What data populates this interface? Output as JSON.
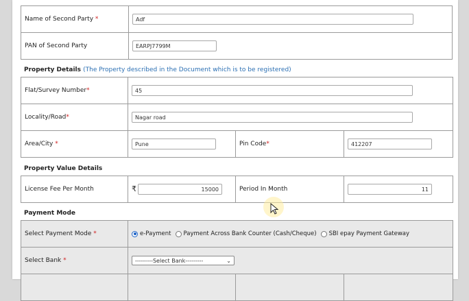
{
  "second_party": {
    "name_label": "Name of Second Party",
    "name_value": "Adf",
    "pan_label": "PAN of Second Party",
    "pan_value": "EARPJ7799M"
  },
  "property": {
    "title": "Property Details",
    "note": "(The Property described in the Document which is to be registered)",
    "flat_label": "Flat/Survey Number",
    "flat_value": "45",
    "locality_label": "Locality/Road",
    "locality_value": "Nagar road",
    "city_label": "Area/City",
    "city_value": "Pune",
    "pin_label": "Pin Code",
    "pin_value": "412207"
  },
  "value_details": {
    "title": "Property Value Details",
    "fee_label": "License Fee Per Month",
    "currency": "₹",
    "fee_value": "15000",
    "period_label": "Period In Month",
    "period_value": "11"
  },
  "payment": {
    "title": "Payment Mode",
    "mode_label": "Select Payment Mode",
    "options": [
      "e-Payment",
      "Payment Across Bank Counter (Cash/Cheque)",
      "SBI epay Payment Gateway"
    ],
    "selected": "e-Payment",
    "bank_label": "Select Bank",
    "bank_value": "---------Select Bank---------"
  },
  "required_marker": "*",
  "colors": {
    "accent": "#1e63c6",
    "note": "#2b6fb3",
    "required": "#d02020"
  }
}
